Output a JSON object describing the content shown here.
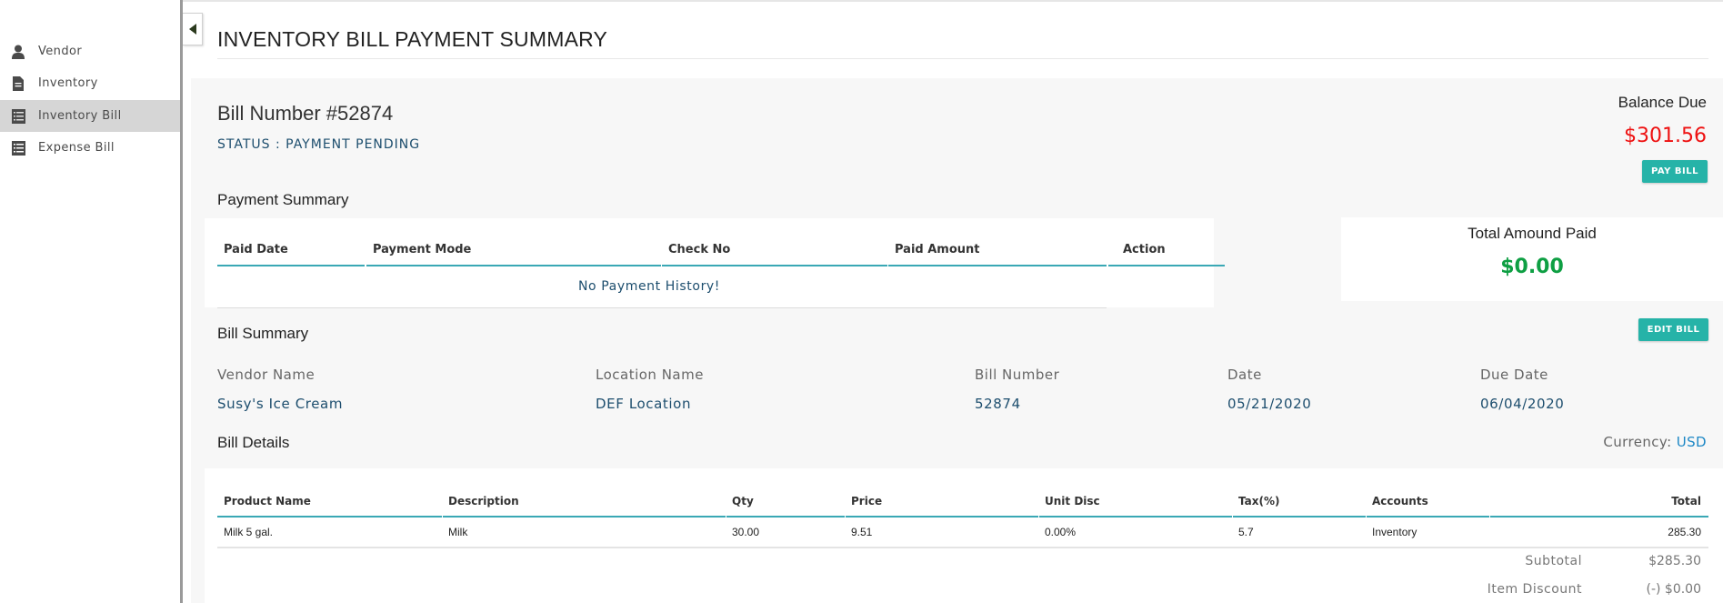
{
  "sidebar": {
    "items": [
      {
        "label": "Vendor",
        "icon": "user-icon",
        "active": false
      },
      {
        "label": "Inventory",
        "icon": "document-icon",
        "active": false
      },
      {
        "label": "Inventory Bill",
        "icon": "list-icon",
        "active": true
      },
      {
        "label": "Expense Bill",
        "icon": "receipt-icon",
        "active": false
      }
    ]
  },
  "header": {
    "title": "INVENTORY BILL PAYMENT SUMMARY"
  },
  "bill": {
    "number_heading": "Bill Number #52874",
    "status": "STATUS : PAYMENT PENDING"
  },
  "balance": {
    "label": "Balance Due",
    "value": "$301.56",
    "pay_button": "PAY BILL"
  },
  "payment_summary": {
    "title": "Payment Summary",
    "columns": [
      "Paid Date",
      "Payment Mode",
      "Check No",
      "Paid Amount",
      "Action"
    ],
    "empty_message": "No Payment History!"
  },
  "total_paid": {
    "label": "Total Amound Paid",
    "value": "$0.00"
  },
  "bill_summary": {
    "title": "Bill Summary",
    "edit_button": "EDIT BILL",
    "fields": [
      {
        "label": "Vendor Name",
        "value": "Susy's Ice Cream"
      },
      {
        "label": "Location Name",
        "value": "DEF Location"
      },
      {
        "label": "Bill Number",
        "value": "52874"
      },
      {
        "label": "Date",
        "value": "05/21/2020"
      },
      {
        "label": "Due Date",
        "value": "06/04/2020"
      }
    ]
  },
  "bill_details": {
    "title": "Bill Details",
    "currency_label": "Currency:",
    "currency_value": "USD",
    "columns": [
      "Product Name",
      "Description",
      "Qty",
      "Price",
      "Unit Disc",
      "Tax(%)",
      "Accounts",
      "Total"
    ],
    "rows": [
      [
        "Milk 5 gal.",
        "Milk",
        "30.00",
        "9.51",
        "0.00%",
        "5.7",
        "Inventory",
        "285.30"
      ]
    ],
    "subtotal_label": "Subtotal",
    "subtotal_value": "$285.30",
    "discount_label": "Item Discount",
    "discount_value": "(-) $0.00"
  },
  "colors": {
    "accent": "#26b3a8",
    "balance_due": "#ee1111",
    "paid": "#0e9f43",
    "link_text": "#1d4e6e",
    "currency": "#1e88c6",
    "table_rule": "#3aa8b5"
  }
}
